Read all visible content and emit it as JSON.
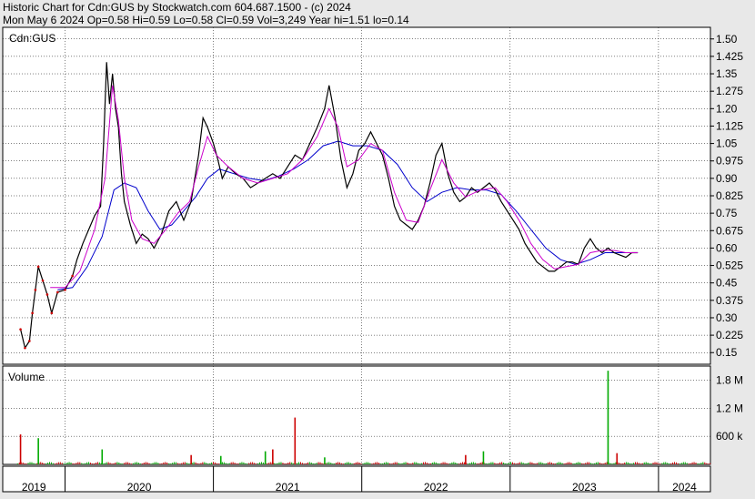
{
  "header": {
    "line1": "Historic Chart for Cdn:GUS by Stockwatch.com 604.687.1500 - (c) 2024",
    "line2": "Mon May  6 2024  Op=0.58  Hi=0.59  Lo=0.58  Cl=0.59  Vol=3,249  Year hi=1.51  lo=0.14"
  },
  "chart_data": [
    {
      "type": "line",
      "panel": "price",
      "ticker_label": "Cdn:GUS",
      "ylim": [
        0.1,
        1.55
      ],
      "y_ticks": [
        "1.50",
        "1.425",
        "1.35",
        "1.275",
        "1.20",
        "1.125",
        "1.05",
        "0.975",
        "0.90",
        "0.825",
        "0.75",
        "0.675",
        "0.60",
        "0.525",
        "0.45",
        "0.375",
        "0.30",
        "0.225",
        "0.15"
      ],
      "x_years": [
        "2019",
        "2020",
        "2021",
        "2022",
        "2023",
        "2024"
      ],
      "x_range": [
        2019.58,
        2024.35
      ],
      "price_series": [
        [
          2019.7,
          0.25
        ],
        [
          2019.73,
          0.17
        ],
        [
          2019.76,
          0.2
        ],
        [
          2019.78,
          0.32
        ],
        [
          2019.8,
          0.42
        ],
        [
          2019.82,
          0.52
        ],
        [
          2019.85,
          0.46
        ],
        [
          2019.88,
          0.4
        ],
        [
          2019.91,
          0.32
        ],
        [
          2019.95,
          0.41
        ],
        [
          2020.0,
          0.42
        ],
        [
          2020.05,
          0.48
        ],
        [
          2020.08,
          0.55
        ],
        [
          2020.12,
          0.62
        ],
        [
          2020.16,
          0.68
        ],
        [
          2020.2,
          0.74
        ],
        [
          2020.24,
          0.78
        ],
        [
          2020.26,
          1.05
        ],
        [
          2020.28,
          1.4
        ],
        [
          2020.3,
          1.22
        ],
        [
          2020.32,
          1.35
        ],
        [
          2020.34,
          1.2
        ],
        [
          2020.36,
          1.12
        ],
        [
          2020.38,
          0.92
        ],
        [
          2020.4,
          0.8
        ],
        [
          2020.44,
          0.7
        ],
        [
          2020.48,
          0.62
        ],
        [
          2020.52,
          0.66
        ],
        [
          2020.56,
          0.64
        ],
        [
          2020.6,
          0.6
        ],
        [
          2020.65,
          0.66
        ],
        [
          2020.7,
          0.76
        ],
        [
          2020.75,
          0.8
        ],
        [
          2020.8,
          0.72
        ],
        [
          2020.85,
          0.8
        ],
        [
          2020.9,
          1.0
        ],
        [
          2020.93,
          1.16
        ],
        [
          2020.96,
          1.12
        ],
        [
          2021.0,
          1.05
        ],
        [
          2021.03,
          0.98
        ],
        [
          2021.06,
          0.9
        ],
        [
          2021.1,
          0.95
        ],
        [
          2021.15,
          0.92
        ],
        [
          2021.2,
          0.9
        ],
        [
          2021.25,
          0.86
        ],
        [
          2021.3,
          0.88
        ],
        [
          2021.35,
          0.9
        ],
        [
          2021.4,
          0.92
        ],
        [
          2021.45,
          0.9
        ],
        [
          2021.5,
          0.95
        ],
        [
          2021.55,
          1.0
        ],
        [
          2021.6,
          0.98
        ],
        [
          2021.65,
          1.05
        ],
        [
          2021.7,
          1.12
        ],
        [
          2021.75,
          1.2
        ],
        [
          2021.78,
          1.3
        ],
        [
          2021.82,
          1.16
        ],
        [
          2021.86,
          0.98
        ],
        [
          2021.9,
          0.86
        ],
        [
          2021.94,
          0.92
        ],
        [
          2021.98,
          1.02
        ],
        [
          2022.02,
          1.05
        ],
        [
          2022.06,
          1.1
        ],
        [
          2022.1,
          1.05
        ],
        [
          2022.14,
          1.0
        ],
        [
          2022.18,
          0.9
        ],
        [
          2022.22,
          0.78
        ],
        [
          2022.26,
          0.72
        ],
        [
          2022.3,
          0.7
        ],
        [
          2022.34,
          0.68
        ],
        [
          2022.38,
          0.72
        ],
        [
          2022.42,
          0.78
        ],
        [
          2022.46,
          0.88
        ],
        [
          2022.5,
          1.0
        ],
        [
          2022.54,
          1.05
        ],
        [
          2022.58,
          0.92
        ],
        [
          2022.62,
          0.84
        ],
        [
          2022.66,
          0.8
        ],
        [
          2022.7,
          0.82
        ],
        [
          2022.74,
          0.86
        ],
        [
          2022.78,
          0.84
        ],
        [
          2022.82,
          0.86
        ],
        [
          2022.86,
          0.88
        ],
        [
          2022.9,
          0.85
        ],
        [
          2022.94,
          0.8
        ],
        [
          2022.98,
          0.76
        ],
        [
          2023.02,
          0.72
        ],
        [
          2023.06,
          0.68
        ],
        [
          2023.1,
          0.62
        ],
        [
          2023.14,
          0.58
        ],
        [
          2023.18,
          0.54
        ],
        [
          2023.22,
          0.52
        ],
        [
          2023.26,
          0.5
        ],
        [
          2023.3,
          0.5
        ],
        [
          2023.34,
          0.52
        ],
        [
          2023.38,
          0.54
        ],
        [
          2023.42,
          0.54
        ],
        [
          2023.46,
          0.53
        ],
        [
          2023.5,
          0.6
        ],
        [
          2023.54,
          0.64
        ],
        [
          2023.58,
          0.6
        ],
        [
          2023.62,
          0.58
        ],
        [
          2023.66,
          0.6
        ],
        [
          2023.7,
          0.58
        ],
        [
          2023.74,
          0.57
        ],
        [
          2023.78,
          0.56
        ],
        [
          2023.82,
          0.58
        ],
        [
          2023.86,
          0.58
        ]
      ],
      "ma_fast": [
        [
          2019.9,
          0.43
        ],
        [
          2020.0,
          0.43
        ],
        [
          2020.1,
          0.5
        ],
        [
          2020.2,
          0.68
        ],
        [
          2020.27,
          0.9
        ],
        [
          2020.32,
          1.3
        ],
        [
          2020.36,
          1.15
        ],
        [
          2020.4,
          0.9
        ],
        [
          2020.45,
          0.72
        ],
        [
          2020.52,
          0.64
        ],
        [
          2020.6,
          0.62
        ],
        [
          2020.68,
          0.68
        ],
        [
          2020.76,
          0.75
        ],
        [
          2020.84,
          0.8
        ],
        [
          2020.9,
          0.95
        ],
        [
          2020.96,
          1.08
        ],
        [
          2021.02,
          1.0
        ],
        [
          2021.1,
          0.95
        ],
        [
          2021.2,
          0.9
        ],
        [
          2021.3,
          0.88
        ],
        [
          2021.4,
          0.9
        ],
        [
          2021.5,
          0.92
        ],
        [
          2021.6,
          0.98
        ],
        [
          2021.7,
          1.08
        ],
        [
          2021.78,
          1.2
        ],
        [
          2021.84,
          1.12
        ],
        [
          2021.9,
          0.95
        ],
        [
          2021.98,
          0.98
        ],
        [
          2022.06,
          1.05
        ],
        [
          2022.14,
          1.02
        ],
        [
          2022.22,
          0.84
        ],
        [
          2022.3,
          0.72
        ],
        [
          2022.38,
          0.71
        ],
        [
          2022.46,
          0.85
        ],
        [
          2022.54,
          0.98
        ],
        [
          2022.62,
          0.88
        ],
        [
          2022.7,
          0.82
        ],
        [
          2022.8,
          0.85
        ],
        [
          2022.9,
          0.86
        ],
        [
          2022.98,
          0.8
        ],
        [
          2023.06,
          0.72
        ],
        [
          2023.14,
          0.62
        ],
        [
          2023.22,
          0.55
        ],
        [
          2023.3,
          0.51
        ],
        [
          2023.38,
          0.52
        ],
        [
          2023.46,
          0.53
        ],
        [
          2023.54,
          0.58
        ],
        [
          2023.62,
          0.59
        ],
        [
          2023.7,
          0.59
        ],
        [
          2023.78,
          0.58
        ],
        [
          2023.86,
          0.58
        ]
      ],
      "ma_slow": [
        [
          2019.95,
          0.42
        ],
        [
          2020.05,
          0.43
        ],
        [
          2020.15,
          0.52
        ],
        [
          2020.25,
          0.65
        ],
        [
          2020.33,
          0.85
        ],
        [
          2020.4,
          0.88
        ],
        [
          2020.48,
          0.86
        ],
        [
          2020.56,
          0.76
        ],
        [
          2020.64,
          0.68
        ],
        [
          2020.72,
          0.7
        ],
        [
          2020.8,
          0.76
        ],
        [
          2020.88,
          0.82
        ],
        [
          2020.96,
          0.9
        ],
        [
          2021.04,
          0.94
        ],
        [
          2021.14,
          0.92
        ],
        [
          2021.24,
          0.9
        ],
        [
          2021.34,
          0.89
        ],
        [
          2021.44,
          0.91
        ],
        [
          2021.54,
          0.94
        ],
        [
          2021.64,
          0.98
        ],
        [
          2021.74,
          1.04
        ],
        [
          2021.84,
          1.06
        ],
        [
          2021.94,
          1.04
        ],
        [
          2022.04,
          1.04
        ],
        [
          2022.14,
          1.02
        ],
        [
          2022.24,
          0.96
        ],
        [
          2022.34,
          0.86
        ],
        [
          2022.44,
          0.8
        ],
        [
          2022.54,
          0.84
        ],
        [
          2022.64,
          0.86
        ],
        [
          2022.74,
          0.85
        ],
        [
          2022.84,
          0.85
        ],
        [
          2022.94,
          0.83
        ],
        [
          2023.04,
          0.76
        ],
        [
          2023.14,
          0.68
        ],
        [
          2023.24,
          0.6
        ],
        [
          2023.34,
          0.55
        ],
        [
          2023.44,
          0.53
        ],
        [
          2023.54,
          0.55
        ],
        [
          2023.64,
          0.58
        ],
        [
          2023.74,
          0.58
        ],
        [
          2023.86,
          0.58
        ]
      ],
      "colors": {
        "price": "#000000",
        "ma_fast": "#cc00cc",
        "ma_slow": "#0000cc",
        "tick_up": "#cc0000"
      }
    },
    {
      "type": "bar",
      "panel": "volume",
      "title": "Volume",
      "y_ticks": [
        "1.8 M",
        "1.2 M",
        "600 k"
      ],
      "ylim": [
        0,
        2100000
      ],
      "spikes": [
        {
          "x": 2019.7,
          "v": 640000
        },
        {
          "x": 2019.82,
          "v": 560000
        },
        {
          "x": 2020.25,
          "v": 320000
        },
        {
          "x": 2020.85,
          "v": 200000
        },
        {
          "x": 2021.05,
          "v": 180000
        },
        {
          "x": 2021.35,
          "v": 280000
        },
        {
          "x": 2021.4,
          "v": 320000
        },
        {
          "x": 2021.55,
          "v": 1000000
        },
        {
          "x": 2021.75,
          "v": 150000
        },
        {
          "x": 2022.7,
          "v": 200000
        },
        {
          "x": 2022.82,
          "v": 280000
        },
        {
          "x": 2023.66,
          "v": 2000000
        },
        {
          "x": 2023.72,
          "v": 240000
        }
      ],
      "baseline_volume": 40000,
      "colors": {
        "up": "#00aa00",
        "down": "#cc0000"
      }
    }
  ]
}
